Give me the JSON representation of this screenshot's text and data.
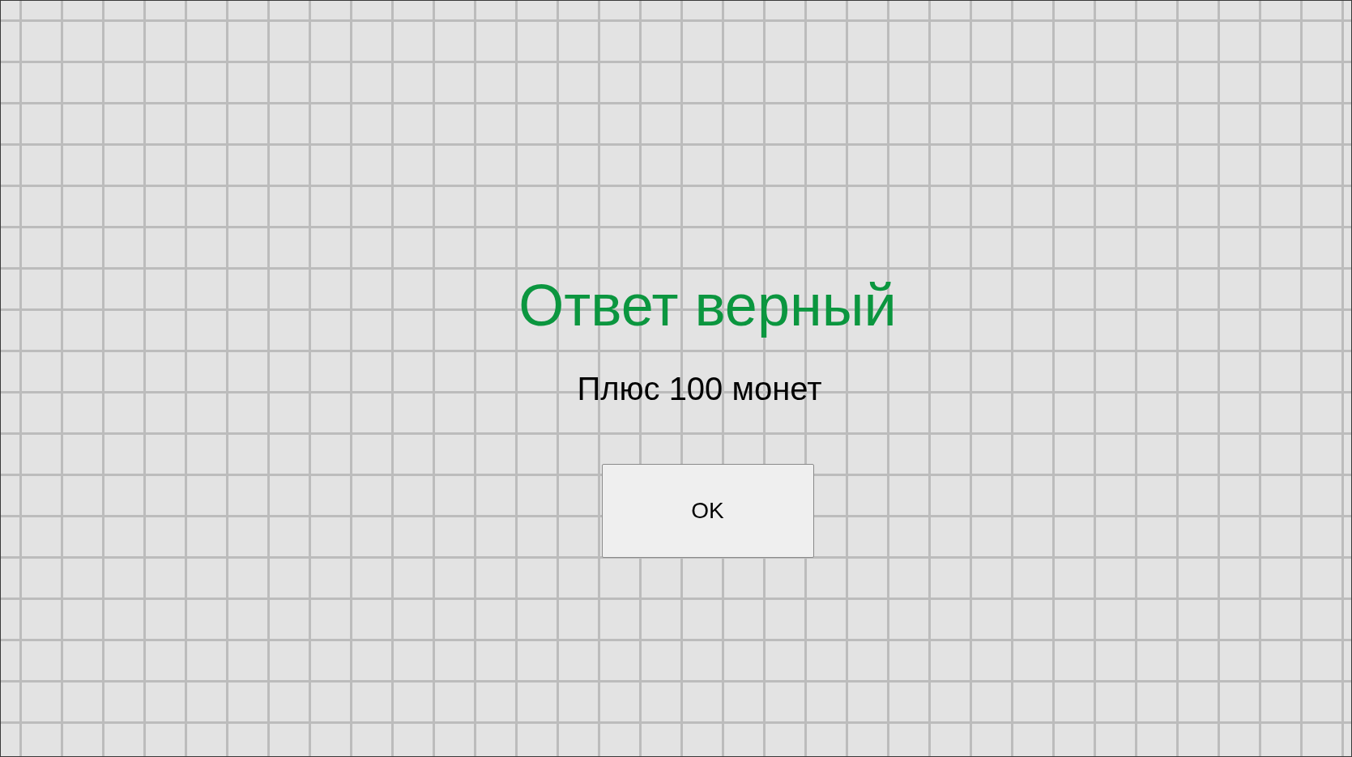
{
  "title": "Ответ верный",
  "message": "Плюс 100 монет",
  "button": {
    "label": "OK"
  }
}
